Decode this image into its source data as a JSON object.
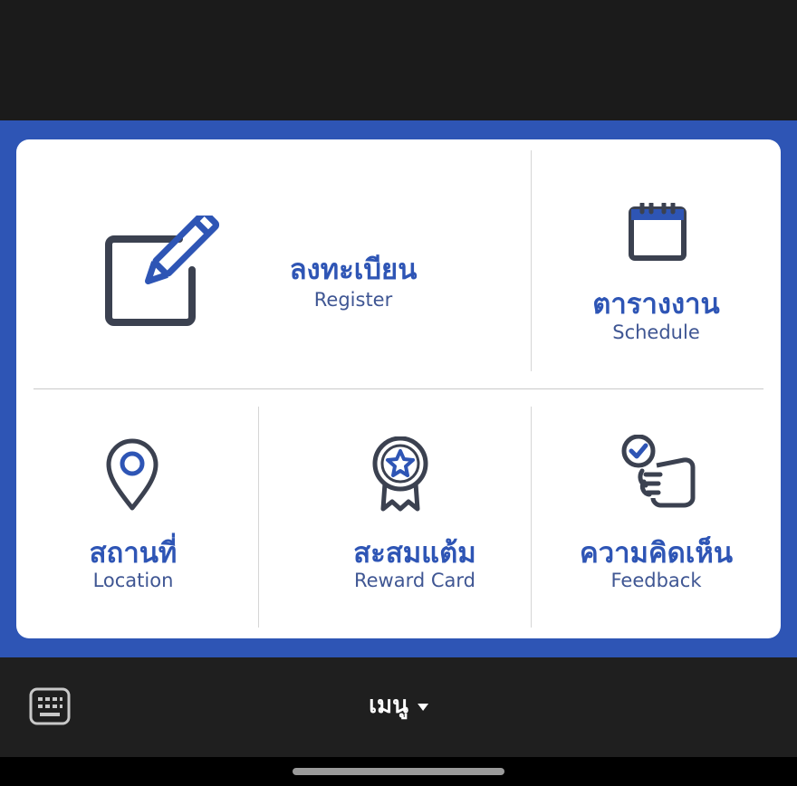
{
  "menu": {
    "items": [
      {
        "id": "register",
        "label_th": "ลงทะเบียน",
        "label_en": "Register",
        "icon": "edit-icon"
      },
      {
        "id": "schedule",
        "label_th": "ตารางงาน",
        "label_en": "Schedule",
        "icon": "calendar-icon"
      },
      {
        "id": "location",
        "label_th": "สถานที่",
        "label_en": "Location",
        "icon": "map-pin-icon"
      },
      {
        "id": "reward",
        "label_th": "สะสมแต้ม",
        "label_en": "Reward Card",
        "icon": "award-star-icon"
      },
      {
        "id": "feedback",
        "label_th": "ความคิดเห็น",
        "label_en": "Feedback",
        "icon": "feedback-hand-check-icon"
      }
    ]
  },
  "bottom_bar": {
    "menu_label": "เมนู",
    "keyboard_icon": "keyboard-icon",
    "caret_icon": "caret-down-icon"
  },
  "colors": {
    "brand_blue": "#2e55b5",
    "icon_dark": "#3b4150",
    "text_blue_dark": "#3f5693",
    "background_dark": "#1b1b1b"
  }
}
